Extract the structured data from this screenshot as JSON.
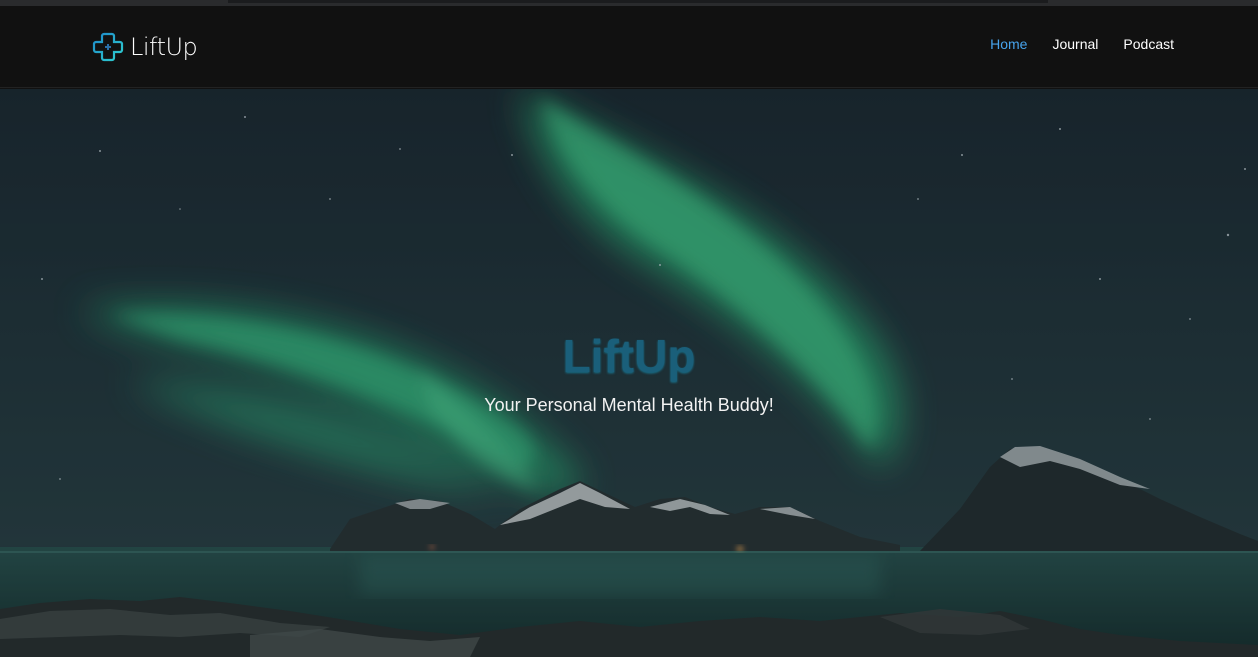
{
  "navbar": {
    "brand": {
      "name": "LiftUp",
      "icon": "plus-cross-logo-icon"
    },
    "links": [
      {
        "label": "Home",
        "active": true
      },
      {
        "label": "Journal",
        "active": false
      },
      {
        "label": "Podcast",
        "active": false
      }
    ]
  },
  "hero": {
    "title": "LiftUp",
    "subtitle": "Your Personal Mental Health Buddy!",
    "background": "aurora-night-landscape-image"
  },
  "colors": {
    "nav_bg": "#111111",
    "active_link": "#47a3ec",
    "hero_title": "#1a5f7a",
    "text": "#ffffff"
  }
}
